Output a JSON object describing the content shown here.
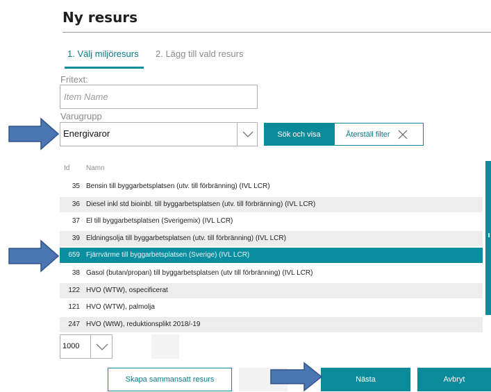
{
  "page": {
    "title": "Ny resurs"
  },
  "tabs": [
    {
      "label": "1. Välj miljöresurs",
      "active": true
    },
    {
      "label": "2. Lägg till vald resurs",
      "active": false
    }
  ],
  "filters": {
    "fritext_label": "Fritext:",
    "fritext_placeholder": "Item Name",
    "varugrupp_label": "Varugrupp",
    "varugrupp_value": "Energivaror",
    "search_button": "Sök och visa",
    "reset_button": "Återställ filter"
  },
  "table": {
    "columns": [
      "Id",
      "Namn"
    ],
    "rows": [
      {
        "id": "35",
        "name": "Bensin till byggarbetsplatsen (utv. till förbränning) (IVL LCR)"
      },
      {
        "id": "36",
        "name": "Diesel inkl std bioinbl. till byggarbetsplatsen (utv. till förbränning) (IVL LCR)"
      },
      {
        "id": "37",
        "name": "El till byggarbetsplatsen (Sverigemix) (IVL LCR)"
      },
      {
        "id": "39",
        "name": "Eldningsolja till byggarbetsplatsen (utv. till förbränning) (IVL LCR)"
      },
      {
        "id": "659",
        "name": "Fjärrvärme till byggarbetsplatsen (Sverige) (IVL LCR)",
        "selected": true
      },
      {
        "id": "38",
        "name": "Gasol (butan/propan) till byggarbetsplatsen (utv till förbränning) (IVL LCR)"
      },
      {
        "id": "122",
        "name": "HVO (WTW), ospecificerat"
      },
      {
        "id": "121",
        "name": "HVO (WTW), palmolja"
      },
      {
        "id": "247",
        "name": "HVO (WtW), reduktionsplikt 2018/-19"
      }
    ]
  },
  "pagination": {
    "page_size": "1000"
  },
  "footer": {
    "composite_button": "Skapa sammansatt resurs",
    "next_button": "Nästa",
    "cancel_button": "Avbryt"
  },
  "colors": {
    "accent": "#0b8a99",
    "arrow": "#4a77b4"
  }
}
